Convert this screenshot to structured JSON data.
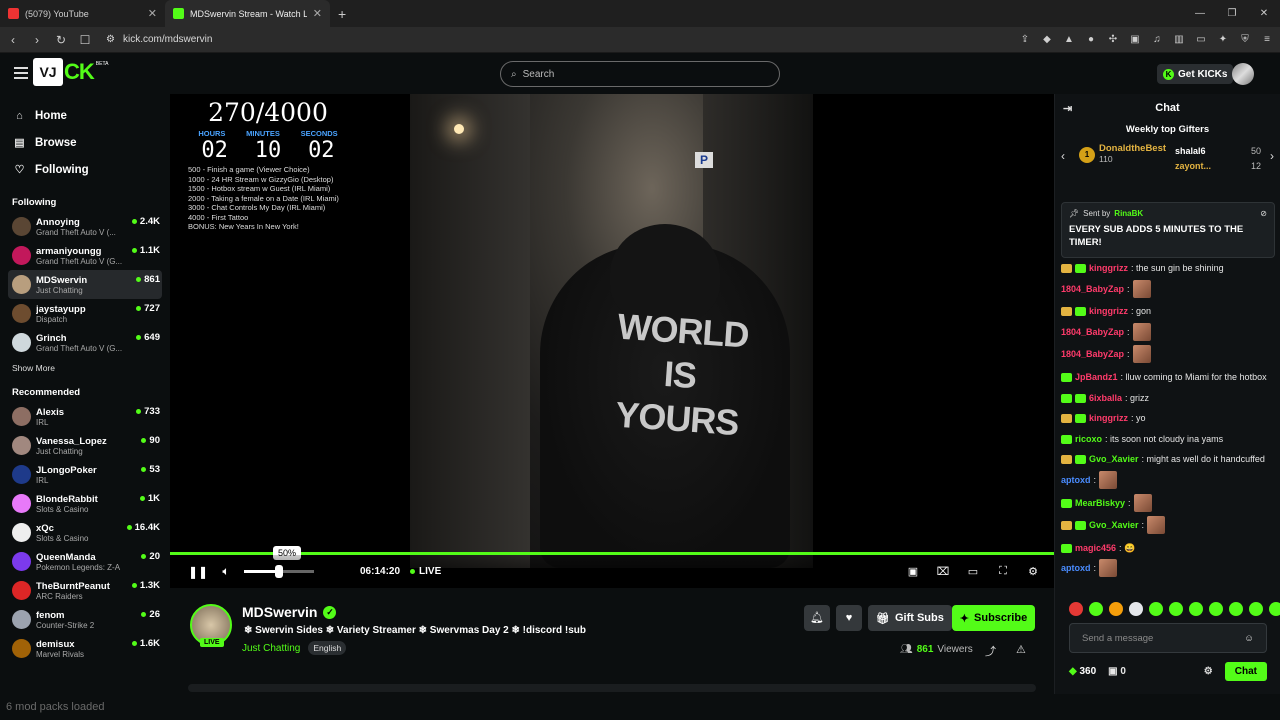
{
  "browser": {
    "tabs": [
      {
        "title": "(5079) YouTube",
        "color": "#e33"
      },
      {
        "title": "MDSwervin Stream - Watch Live",
        "color": "#53fc18"
      }
    ],
    "url": "kick.com/mdswervin"
  },
  "header": {
    "logo_badge": "VJ",
    "logo_text": "CK",
    "logo_beta": "BETA",
    "search_placeholder": "Search",
    "get_kicks": "Get KICKs"
  },
  "sidebar": {
    "nav": [
      {
        "label": "Home",
        "icon": "⌂"
      },
      {
        "label": "Browse",
        "icon": "▤"
      },
      {
        "label": "Following",
        "icon": "♡"
      }
    ],
    "following_title": "Following",
    "following": [
      {
        "name": "Annoying",
        "category": "Grand Theft Auto V (...",
        "viewers": "2.4K",
        "color": "#5a4634"
      },
      {
        "name": "armaniyoungg",
        "category": "Grand Theft Auto V (G...",
        "viewers": "1.1K",
        "color": "#c2185b"
      },
      {
        "name": "MDSwervin",
        "category": "Just Chatting",
        "viewers": "861",
        "color": "#b89e7e"
      },
      {
        "name": "jaystayupp",
        "category": "Dispatch",
        "viewers": "727",
        "color": "#6d4c2f"
      },
      {
        "name": "Grinch",
        "category": "Grand Theft Auto V (G...",
        "viewers": "649",
        "color": "#cfd8dc"
      }
    ],
    "show_more": "Show More",
    "recommended_title": "Recommended",
    "recommended": [
      {
        "name": "Alexis",
        "category": "IRL",
        "viewers": "733",
        "color": "#8d6e63"
      },
      {
        "name": "Vanessa_Lopez",
        "category": "Just Chatting",
        "viewers": "90",
        "color": "#a1887f"
      },
      {
        "name": "JLongoPoker",
        "category": "IRL",
        "viewers": "53",
        "color": "#1e3a8a"
      },
      {
        "name": "BlondeRabbit",
        "category": "Slots & Casino",
        "viewers": "1K",
        "color": "#e879f9"
      },
      {
        "name": "xQc",
        "category": "Slots & Casino",
        "viewers": "16.4K",
        "color": "#eeeeee"
      },
      {
        "name": "QueenManda",
        "category": "Pokemon Legends: Z-A",
        "viewers": "20",
        "color": "#7c3aed"
      },
      {
        "name": "TheBurntPeanut",
        "category": "ARC Raiders",
        "viewers": "1.3K",
        "color": "#dc2626"
      },
      {
        "name": "fenom",
        "category": "Counter-Strike 2",
        "viewers": "26",
        "color": "#9ca3af"
      },
      {
        "name": "demisux",
        "category": "Marvel Rivals",
        "viewers": "1.6K",
        "color": "#a16207"
      }
    ]
  },
  "video": {
    "goal_count": "270/4000",
    "labels": [
      "HOURS",
      "MINUTES",
      "SECONDS"
    ],
    "timer": [
      "02",
      "10",
      "02"
    ],
    "goals": [
      "500 - Finish a game (Viewer Choice)",
      "1000 - 24 HR Stream w GizzyGio (Desktop)",
      "1500 - Hotbox stream w Guest (IRL Miami)",
      "2000 - Taking a female on a Date (IRL Miami)",
      "3000 - Chat Controls My Day (IRL Miami)",
      "4000 - First Tattoo",
      "BONUS: New Years In New York!"
    ],
    "shirt_text": [
      "WORLD",
      "IS",
      "YOURS"
    ],
    "volume_tip": "50%",
    "volume_level": 0.5,
    "time": "06:14:20",
    "live": "LIVE"
  },
  "stream": {
    "name": "MDSwervin",
    "live_badge": "LIVE",
    "title": "❄ Swervin Sides ❄ Variety Streamer ❄ Swervmas Day 2 ❄ !discord !sub",
    "category": "Just Chatting",
    "language": "English",
    "gift_subs": "Gift Subs",
    "subscribe": "Subscribe",
    "viewers": "861",
    "viewers_label": "Viewers"
  },
  "chat": {
    "title": "Chat",
    "gifters_title": "Weekly top Gifters",
    "top_gifter": {
      "rank": "1",
      "name": "DonaldtheBest",
      "count": "110"
    },
    "gifters": [
      {
        "name": "shalal6",
        "count": "50"
      },
      {
        "name": "zayont...",
        "count": "12"
      }
    ],
    "pinned": {
      "sent_by": "Sent by",
      "user": "RinaBK",
      "message": "EVERY SUB ADDS 5 MINUTES TO THE TIMER!"
    },
    "messages": [
      {
        "user": "kinggrizz",
        "color": "#ff3b6b",
        "text": ": the sun gin be shining",
        "badges": [
          "#e3b341",
          "#53fc18"
        ],
        "emote": false
      },
      {
        "user": "1804_BabyZap",
        "color": "#ff3b6b",
        "text": ":",
        "badges": [],
        "emote": true
      },
      {
        "user": "kinggrizz",
        "color": "#ff3b6b",
        "text": ": gon",
        "badges": [
          "#e3b341",
          "#53fc18"
        ],
        "emote": false
      },
      {
        "user": "1804_BabyZap",
        "color": "#ff3b6b",
        "text": ":",
        "badges": [],
        "emote": true
      },
      {
        "user": "1804_BabyZap",
        "color": "#ff3b6b",
        "text": ":",
        "badges": [],
        "emote": true
      },
      {
        "user": "JpBandz1",
        "color": "#ff3b6b",
        "text": ": lluw coming to Miami for the hotbox",
        "badges": [
          "#53fc18"
        ],
        "emote": false
      },
      {
        "user": "6ixballa",
        "color": "#ff3b6b",
        "text": ": grizz",
        "badges": [
          "#53fc18",
          "#53fc18"
        ],
        "emote": false
      },
      {
        "user": "kinggrizz",
        "color": "#ff3b6b",
        "text": ": yo",
        "badges": [
          "#e3b341",
          "#53fc18"
        ],
        "emote": false
      },
      {
        "user": "ricoxo",
        "color": "#53fc18",
        "text": ": its soon not cloudy ina yams",
        "badges": [
          "#53fc18"
        ],
        "emote": false
      },
      {
        "user": "Gvo_Xavier",
        "color": "#53fc18",
        "text": ": might as well do it handcuffed",
        "badges": [
          "#e3b341",
          "#53fc18"
        ],
        "emote": false
      },
      {
        "user": "aptoxd",
        "color": "#4a8cff",
        "text": ":",
        "badges": [],
        "emote": true
      },
      {
        "user": "MearBiskyy",
        "color": "#53fc18",
        "text": ":",
        "badges": [
          "#53fc18"
        ],
        "emote": true
      },
      {
        "user": "Gvo_Xavier",
        "color": "#53fc18",
        "text": ":",
        "badges": [
          "#e3b341",
          "#53fc18"
        ],
        "emote": true
      },
      {
        "user": "magic456",
        "color": "#ff3b6b",
        "text": ": 😄",
        "badges": [
          "#53fc18"
        ],
        "emote": false
      },
      {
        "user": "aptoxd",
        "color": "#4a8cff",
        "text": ":",
        "badges": [],
        "emote": true
      }
    ],
    "input_placeholder": "Send a message",
    "kicks": "360",
    "gifts": "0",
    "chat_button": "Chat"
  },
  "status": "6 mod packs loaded"
}
